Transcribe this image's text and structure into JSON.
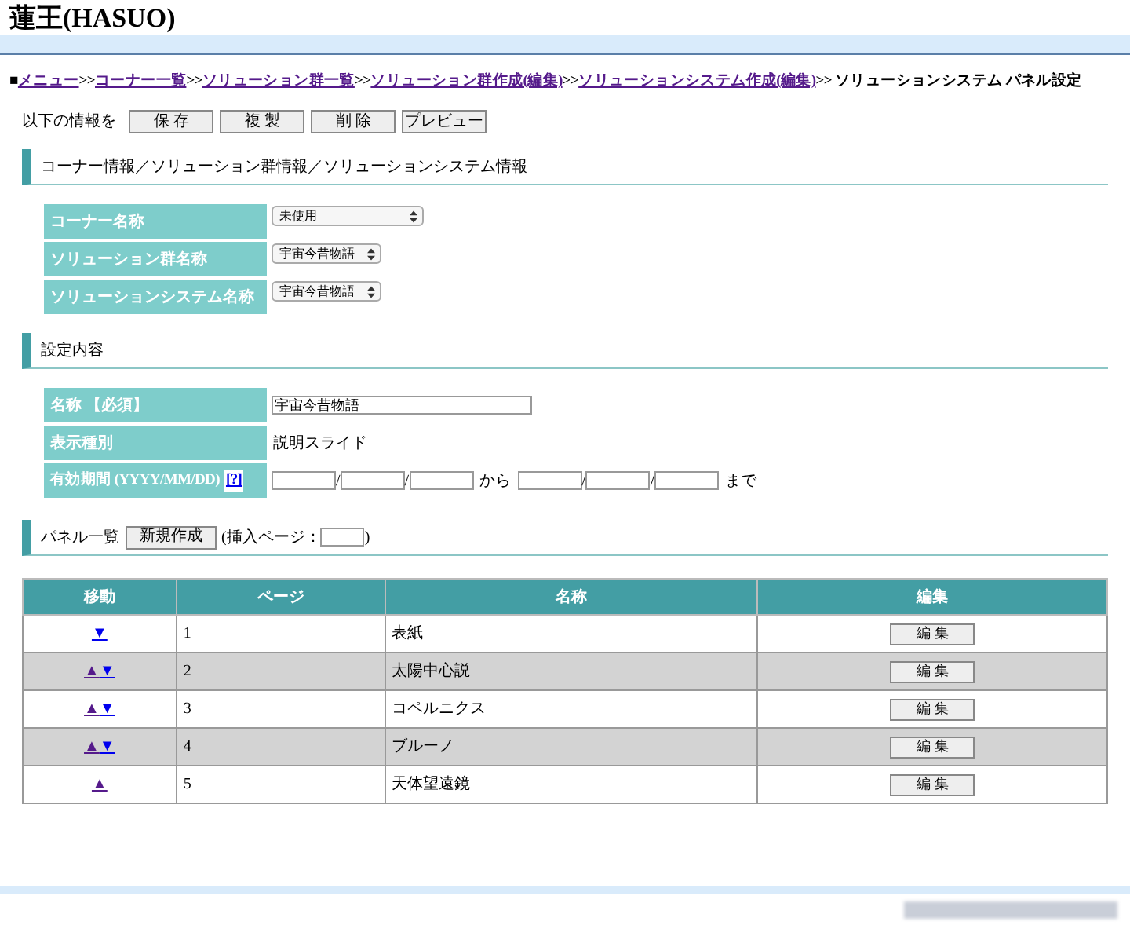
{
  "title": "蓮王(HASUO)",
  "breadcrumb": {
    "prefix": "■",
    "links": [
      {
        "label": "メニュー",
        "visited": true
      },
      {
        "label": "コーナー一覧",
        "visited": true
      },
      {
        "label": "ソリューション群一覧",
        "visited": true
      },
      {
        "label": "ソリューション群作成(編集)",
        "visited": true
      },
      {
        "label": "ソリューションシステム作成(編集)",
        "visited": true
      }
    ],
    "separator": ">>",
    "current": "ソリューションシステム パネル設定"
  },
  "action_bar": {
    "label": "以下の情報を",
    "buttons": [
      "保 存",
      "複 製",
      "削 除",
      "プレビュー"
    ]
  },
  "section_1": {
    "heading": "コーナー情報／ソリューション群情報／ソリューションシステム情報",
    "fields": [
      {
        "label": "コーナー名称",
        "value": "未使用",
        "wide": true
      },
      {
        "label": "ソリューション群名称",
        "value": "宇宙今昔物語",
        "wide": false
      },
      {
        "label": "ソリューションシステム名称",
        "value": "宇宙今昔物語",
        "wide": false
      }
    ]
  },
  "section_2": {
    "heading": "設定内容",
    "name_label": "名称 【必須】",
    "name_value": "宇宙今昔物語",
    "type_label": "表示種別",
    "type_value": "説明スライド",
    "period_label": "有効期間 (YYYY/MM/DD)",
    "help_link": "[?]",
    "from_text": "から",
    "to_text": "まで",
    "date_separator": "/"
  },
  "section_3": {
    "heading": "パネル一覧",
    "new_button": "新規作成",
    "insert_prefix": "(挿入ページ：",
    "insert_suffix": ")"
  },
  "table": {
    "columns": [
      "移動",
      "ページ",
      "名称",
      "編集"
    ],
    "rows": [
      {
        "up": false,
        "down": true,
        "page": "1",
        "name": "表紙",
        "edit": "編 集"
      },
      {
        "up": true,
        "down": true,
        "page": "2",
        "name": "太陽中心説",
        "edit": "編 集"
      },
      {
        "up": true,
        "down": true,
        "page": "3",
        "name": "コペルニクス",
        "edit": "編 集"
      },
      {
        "up": true,
        "down": true,
        "page": "4",
        "name": "ブルーノ",
        "edit": "編 集"
      },
      {
        "up": true,
        "down": false,
        "page": "5",
        "name": "天体望遠鏡",
        "edit": "編 集"
      }
    ],
    "up_glyph": "▲",
    "down_glyph": "▼"
  }
}
